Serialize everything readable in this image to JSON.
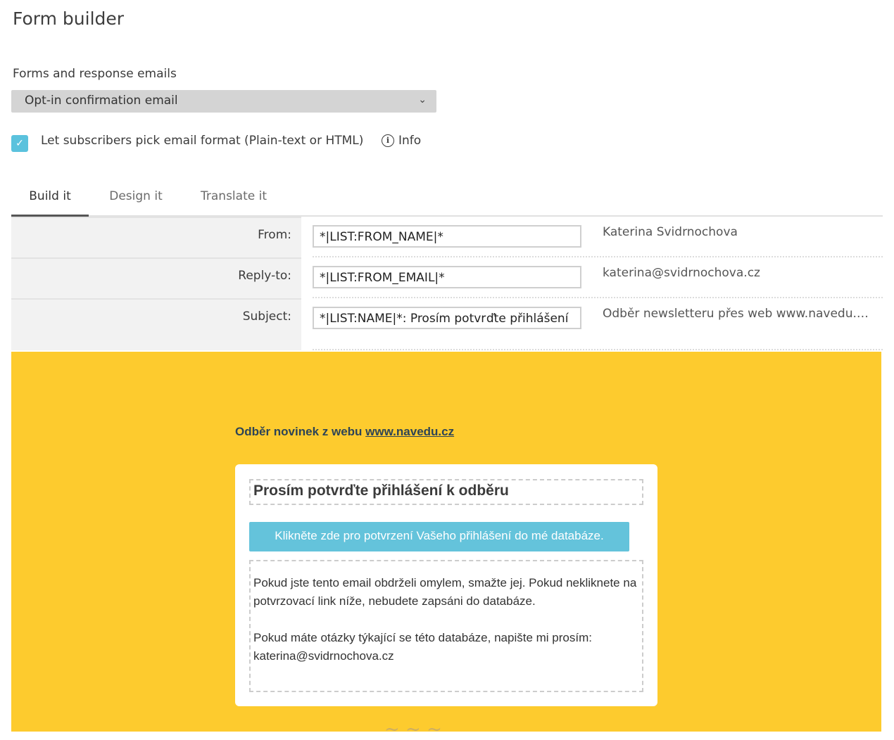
{
  "page": {
    "title": "Form builder"
  },
  "forms": {
    "section_label": "Forms and response emails",
    "selected": "Opt-in confirmation email"
  },
  "format_option": {
    "label": "Let subscribers pick email format (Plain-text or HTML)",
    "checked": true,
    "info_label": "Info"
  },
  "tabs": [
    {
      "label": "Build it",
      "active": true
    },
    {
      "label": "Design it",
      "active": false
    },
    {
      "label": "Translate it",
      "active": false
    }
  ],
  "fields": [
    {
      "label": "From:",
      "value": "*|LIST:FROM_NAME|*",
      "resolved": "Katerina Svidrnochova"
    },
    {
      "label": "Reply-to:",
      "value": "*|LIST:FROM_EMAIL|*",
      "resolved": "katerina@svidrnochova.cz"
    },
    {
      "label": "Subject:",
      "value": "*|LIST:NAME|*: Prosím potvrďte přihlášení",
      "resolved": "Odběr newsletteru přes web www.navedu.c..."
    }
  ],
  "preview": {
    "preheader_text": "Odběr novinek z webu ",
    "preheader_link": "www.navedu.cz",
    "title": "Prosím potvrďte přihlášení k odběru",
    "button_label": "Klikněte zde pro potvrzení Vašeho přihlášení do mé databáze.",
    "body_p1": "Pokud jste tento email obdrželi omylem, smažte jej. Pokud nekliknete na potvrzovací link níže, nebudete zapsáni do databáze.",
    "body_p2": "Pokud máte otázky týkající se této databáze, napište mi prosím: katerina@svidrnochova.cz"
  },
  "colors": {
    "preview_bg": "#fdcb2e",
    "button_bg": "#64c3db",
    "checkbox": "#5bc2dd"
  }
}
